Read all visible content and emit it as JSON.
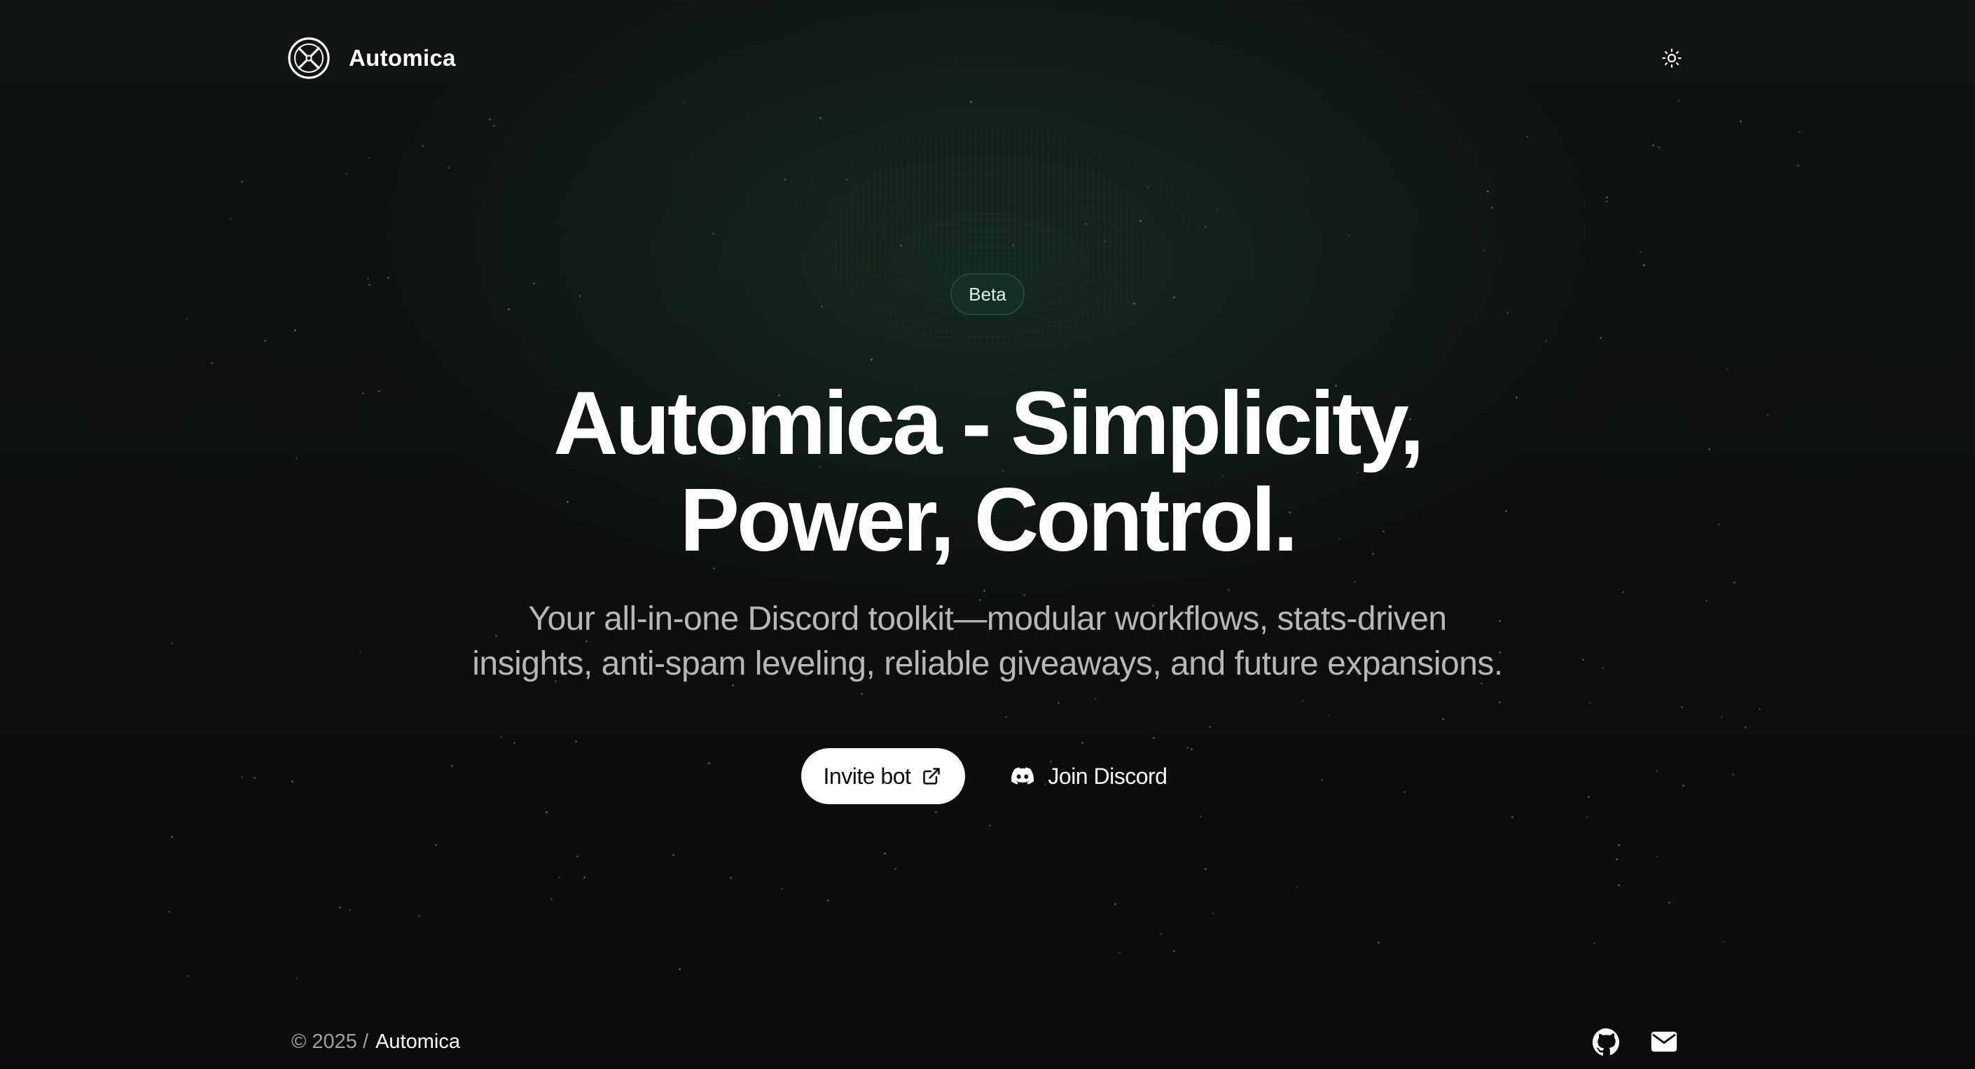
{
  "header": {
    "brand_name": "Automica",
    "logo_icon": "automica-logo-icon",
    "theme_toggle_icon": "sun-icon"
  },
  "hero": {
    "badge": "Beta",
    "headline_line1": "Automica - Simplicity,",
    "headline_line2": "Power, Control.",
    "subtitle_line1": "Your all-in-one Discord toolkit—modular workflows, stats-driven",
    "subtitle_line2": "insights, anti-spam leveling, reliable giveaways, and future expansions.",
    "invite_label": "Invite bot",
    "invite_icon": "external-link-icon",
    "discord_label": "Join Discord",
    "discord_icon": "discord-icon"
  },
  "footer": {
    "copyright": "© 2025 /",
    "brand_link": "Automica",
    "social_icons": [
      "github-icon",
      "mail-icon"
    ]
  },
  "colors": {
    "background": "#0b0c0c",
    "accent_green": "#1a3a2c",
    "badge_border": "#24473a",
    "text_primary": "#ffffff",
    "text_muted": "#b5b8b6"
  }
}
